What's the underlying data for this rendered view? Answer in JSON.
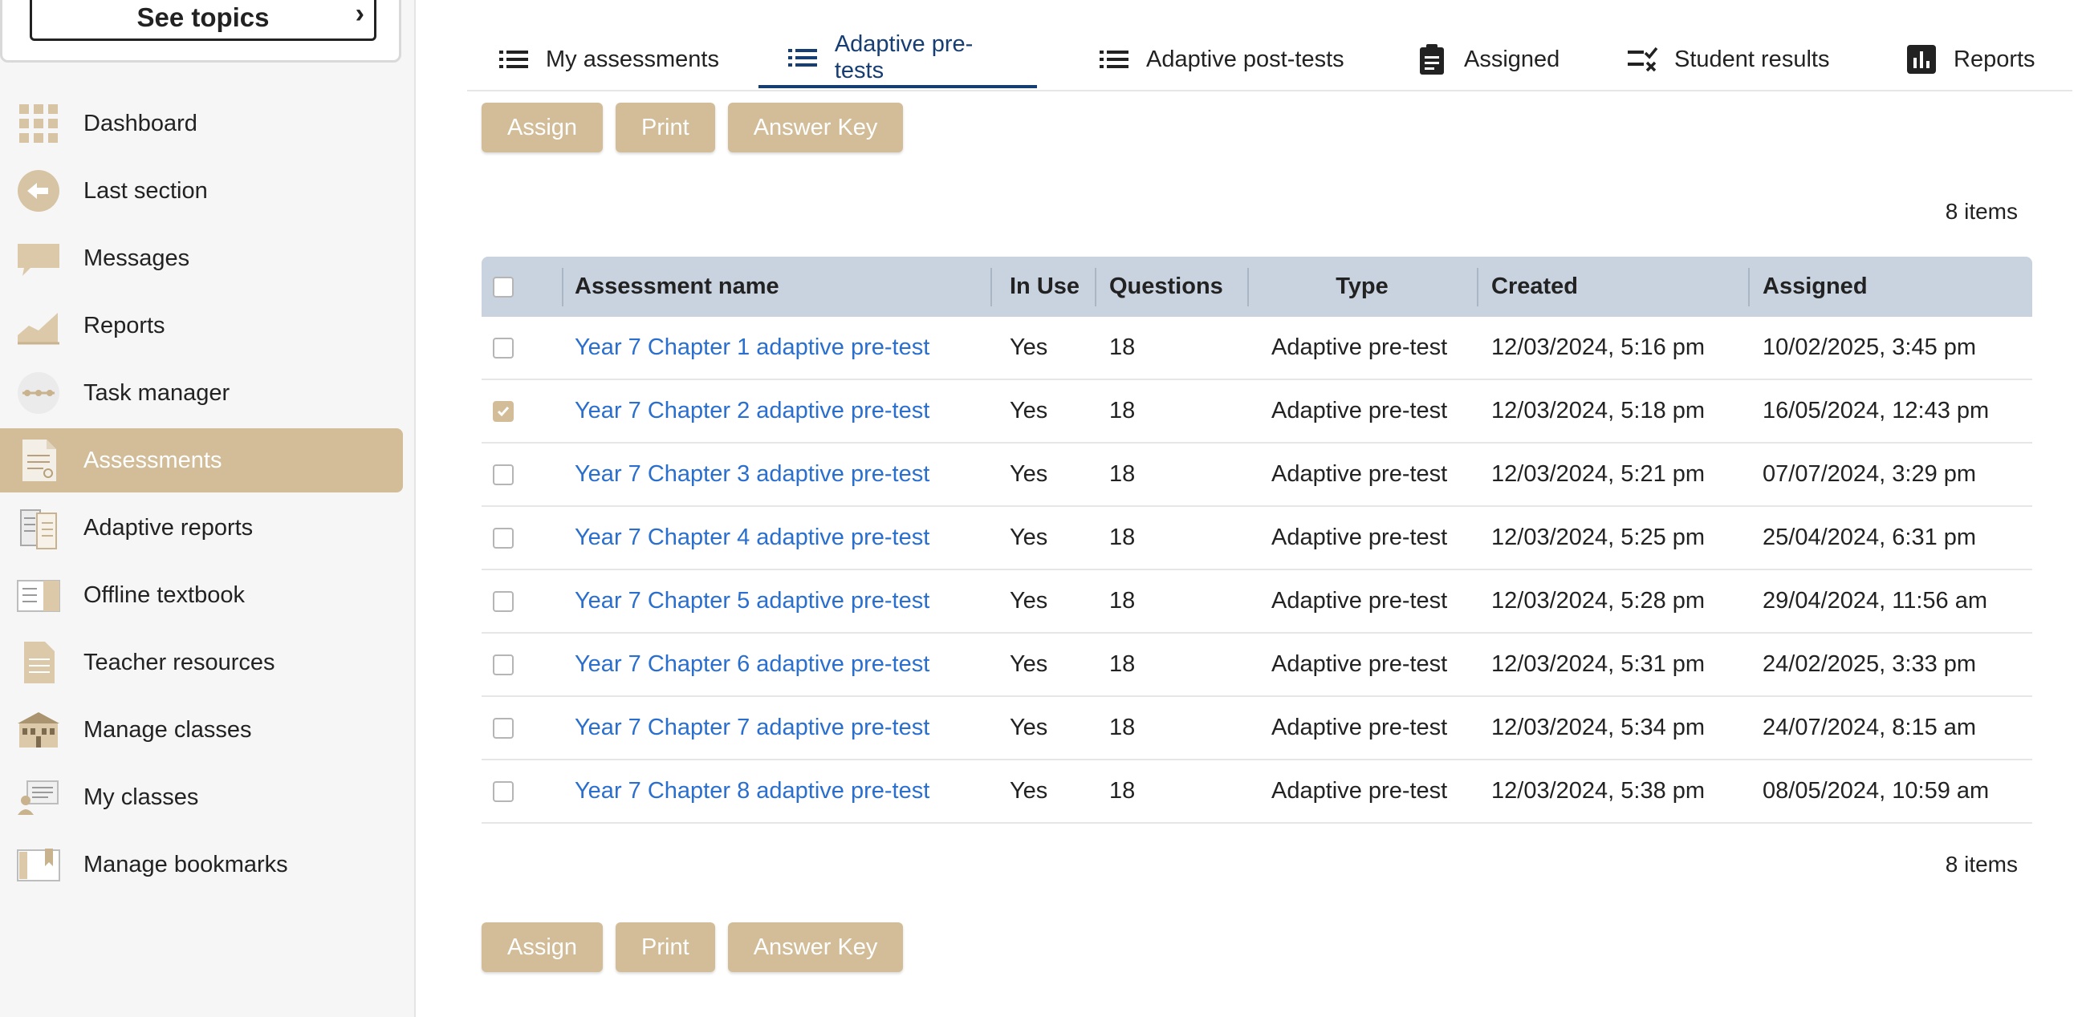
{
  "sidebar": {
    "see_topics_label": "See topics",
    "items": [
      {
        "label": "Dashboard",
        "icon": "dashboard-grid-icon"
      },
      {
        "label": "Last section",
        "icon": "back-arrow-icon"
      },
      {
        "label": "Messages",
        "icon": "speech-bubble-icon"
      },
      {
        "label": "Reports",
        "icon": "area-chart-icon"
      },
      {
        "label": "Task manager",
        "icon": "task-manager-icon"
      },
      {
        "label": "Assessments",
        "icon": "document-icon",
        "active": true
      },
      {
        "label": "Adaptive reports",
        "icon": "adaptive-reports-icon"
      },
      {
        "label": "Offline textbook",
        "icon": "textbook-icon"
      },
      {
        "label": "Teacher resources",
        "icon": "resource-document-icon"
      },
      {
        "label": "Manage classes",
        "icon": "school-building-icon"
      },
      {
        "label": "My classes",
        "icon": "classroom-icon"
      },
      {
        "label": "Manage bookmarks",
        "icon": "bookmark-book-icon"
      }
    ]
  },
  "tabs": [
    {
      "label": "My assessments",
      "icon": "list-icon"
    },
    {
      "label": "Adaptive pre-tests",
      "icon": "list-icon",
      "active": true
    },
    {
      "label": "Adaptive post-tests",
      "icon": "list-icon"
    },
    {
      "label": "Assigned",
      "icon": "clipboard-icon"
    },
    {
      "label": "Student results",
      "icon": "checklist-icon"
    },
    {
      "label": "Reports",
      "icon": "bar-chart-icon"
    }
  ],
  "actions": {
    "assign": "Assign",
    "print": "Print",
    "answer_key": "Answer Key"
  },
  "items_count": "8 items",
  "table": {
    "headers": {
      "name": "Assessment name",
      "in_use": "In Use",
      "questions": "Questions",
      "type": "Type",
      "created": "Created",
      "assigned": "Assigned"
    },
    "rows": [
      {
        "checked": false,
        "name": "Year 7 Chapter 1 adaptive pre-test",
        "in_use": "Yes",
        "questions": "18",
        "type": "Adaptive pre-test",
        "created": "12/03/2024, 5:16 pm",
        "assigned": "10/02/2025, 3:45 pm"
      },
      {
        "checked": true,
        "name": "Year 7 Chapter 2 adaptive pre-test",
        "in_use": "Yes",
        "questions": "18",
        "type": "Adaptive pre-test",
        "created": "12/03/2024, 5:18 pm",
        "assigned": "16/05/2024, 12:43 pm"
      },
      {
        "checked": false,
        "name": "Year 7 Chapter 3 adaptive pre-test",
        "in_use": "Yes",
        "questions": "18",
        "type": "Adaptive pre-test",
        "created": "12/03/2024, 5:21 pm",
        "assigned": "07/07/2024, 3:29 pm"
      },
      {
        "checked": false,
        "name": "Year 7 Chapter 4 adaptive pre-test",
        "in_use": "Yes",
        "questions": "18",
        "type": "Adaptive pre-test",
        "created": "12/03/2024, 5:25 pm",
        "assigned": "25/04/2024, 6:31 pm"
      },
      {
        "checked": false,
        "name": "Year 7 Chapter 5 adaptive pre-test",
        "in_use": "Yes",
        "questions": "18",
        "type": "Adaptive pre-test",
        "created": "12/03/2024, 5:28 pm",
        "assigned": "29/04/2024, 11:56 am"
      },
      {
        "checked": false,
        "name": "Year 7 Chapter 6 adaptive pre-test",
        "in_use": "Yes",
        "questions": "18",
        "type": "Adaptive pre-test",
        "created": "12/03/2024, 5:31 pm",
        "assigned": "24/02/2025, 3:33 pm"
      },
      {
        "checked": false,
        "name": "Year 7 Chapter 7 adaptive pre-test",
        "in_use": "Yes",
        "questions": "18",
        "type": "Adaptive pre-test",
        "created": "12/03/2024, 5:34 pm",
        "assigned": "24/07/2024, 8:15 am"
      },
      {
        "checked": false,
        "name": "Year 7 Chapter 8 adaptive pre-test",
        "in_use": "Yes",
        "questions": "18",
        "type": "Adaptive pre-test",
        "created": "12/03/2024, 5:38 pm",
        "assigned": "08/05/2024, 10:59 am"
      }
    ]
  },
  "colors": {
    "accent": "#d2bd98",
    "link": "#2a6fce",
    "active_tab": "#163e73",
    "table_header": "#c8d3df"
  }
}
